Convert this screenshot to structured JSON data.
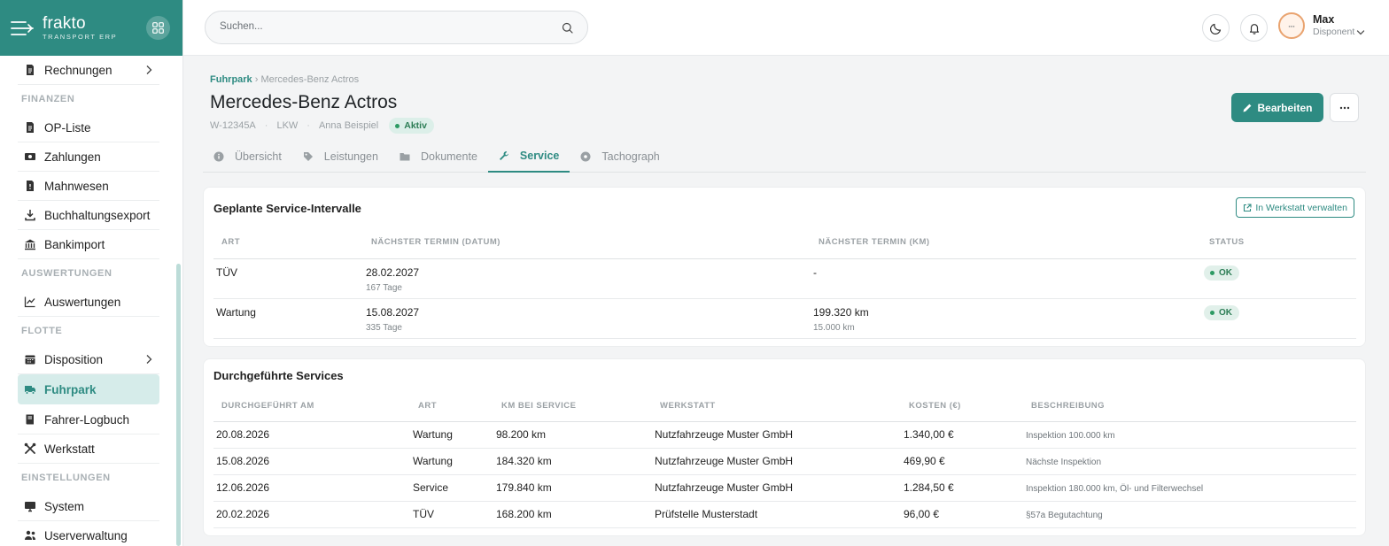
{
  "brand": {
    "name": "frakto",
    "sub": "TRANSPORT ERP"
  },
  "sidebar": {
    "items": [
      {
        "type": "item",
        "label": "Rechnungen",
        "icon": "invoice-icon",
        "chevron": true
      },
      {
        "type": "section",
        "label": "FINANZEN"
      },
      {
        "type": "item",
        "label": "OP-Liste",
        "icon": "document-icon"
      },
      {
        "type": "item",
        "label": "Zahlungen",
        "icon": "money-icon"
      },
      {
        "type": "item",
        "label": "Mahnwesen",
        "icon": "reminder-icon"
      },
      {
        "type": "item",
        "label": "Buchhaltungsexport",
        "icon": "download-icon"
      },
      {
        "type": "item",
        "label": "Bankimport",
        "icon": "bank-icon"
      },
      {
        "type": "section",
        "label": "AUSWERTUNGEN"
      },
      {
        "type": "item",
        "label": "Auswertungen",
        "icon": "chart-line-icon"
      },
      {
        "type": "section",
        "label": "FLOTTE"
      },
      {
        "type": "item",
        "label": "Disposition",
        "icon": "calendar-icon",
        "chevron": true
      },
      {
        "type": "item",
        "label": "Fuhrpark",
        "icon": "truck-icon",
        "active": true
      },
      {
        "type": "item",
        "label": "Fahrer-Logbuch",
        "icon": "book-icon"
      },
      {
        "type": "item",
        "label": "Werkstatt",
        "icon": "tools-icon"
      },
      {
        "type": "section",
        "label": "EINSTELLUNGEN"
      },
      {
        "type": "item",
        "label": "System",
        "icon": "monitor-icon"
      },
      {
        "type": "item",
        "label": "Userverwaltung",
        "icon": "users-icon"
      }
    ]
  },
  "header": {
    "search_placeholder": "Suchen...",
    "user_name": "Max",
    "user_role": "Disponent"
  },
  "page": {
    "breadcrumb_root": "Fuhrpark",
    "breadcrumb_current": "Mercedes-Benz Actros",
    "title": "Mercedes-Benz Actros",
    "plate": "W-12345A",
    "vehicle_type": "LKW",
    "driver": "Anna Beispiel",
    "status": "Aktiv",
    "edit_label": "Bearbeiten"
  },
  "tabs": [
    {
      "label": "Übersicht",
      "icon": "info-icon"
    },
    {
      "label": "Leistungen",
      "icon": "tag-icon"
    },
    {
      "label": "Dokumente",
      "icon": "folder-icon"
    },
    {
      "label": "Service",
      "icon": "wrench-icon",
      "active": true
    },
    {
      "label": "Tachograph",
      "icon": "disc-icon"
    }
  ],
  "planned": {
    "title": "Geplante Service-Intervalle",
    "workshop_button": "In Werkstatt verwalten",
    "headers": [
      "ART",
      "NÄCHSTER TERMIN (DATUM)",
      "NÄCHSTER TERMIN (KM)",
      "STATUS"
    ],
    "rows": [
      {
        "art": "TÜV",
        "date": "28.02.2027",
        "date_sub": "167 Tage",
        "km": "-",
        "km_sub": "",
        "status": "OK"
      },
      {
        "art": "Wartung",
        "date": "15.08.2027",
        "date_sub": "335 Tage",
        "km": "199.320 km",
        "km_sub": "15.000 km",
        "status": "OK"
      }
    ]
  },
  "done": {
    "title": "Durchgeführte Services",
    "headers": [
      "DURCHGEFÜHRT AM",
      "ART",
      "KM BEI SERVICE",
      "WERKSTATT",
      "KOSTEN (€)",
      "BESCHREIBUNG"
    ],
    "rows": [
      {
        "date": "20.08.2026",
        "art": "Wartung",
        "km": "98.200 km",
        "werkstatt": "Nutzfahrzeuge Muster GmbH",
        "kosten": "1.340,00 €",
        "beschreibung": "Inspektion 100.000 km"
      },
      {
        "date": "15.08.2026",
        "art": "Wartung",
        "km": "184.320 km",
        "werkstatt": "Nutzfahrzeuge Muster GmbH",
        "kosten": "469,90 €",
        "beschreibung": "Nächste Inspektion"
      },
      {
        "date": "12.06.2026",
        "art": "Service",
        "km": "179.840 km",
        "werkstatt": "Nutzfahrzeuge Muster GmbH",
        "kosten": "1.284,50 €",
        "beschreibung": "Inspektion 180.000 km, Öl- und Filterwechsel"
      },
      {
        "date": "20.02.2026",
        "art": "TÜV",
        "km": "168.200 km",
        "werkstatt": "Prüfstelle Musterstadt",
        "kosten": "96,00 €",
        "beschreibung": "§57a Begutachtung"
      }
    ]
  },
  "colors": {
    "accent": "#2e8b82",
    "accent_light": "#d6ecea",
    "ok_bg": "#e1f0ea",
    "ok_text": "#2c7d55"
  }
}
